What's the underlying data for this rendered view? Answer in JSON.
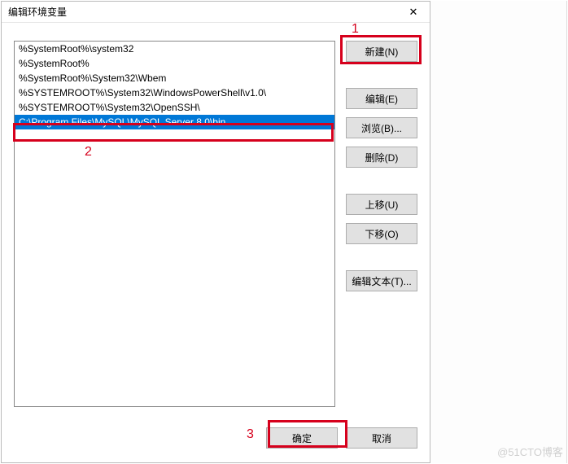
{
  "dialog": {
    "title": "编辑环境变量",
    "close": "✕"
  },
  "list": {
    "items": [
      "%SystemRoot%\\system32",
      "%SystemRoot%",
      "%SystemRoot%\\System32\\Wbem",
      "%SYSTEMROOT%\\System32\\WindowsPowerShell\\v1.0\\",
      "%SYSTEMROOT%\\System32\\OpenSSH\\",
      "C:\\Program Files\\MySQL\\MySQL Server 8.0\\bin"
    ],
    "selected_index": 5
  },
  "buttons": {
    "new": "新建(N)",
    "edit": "编辑(E)",
    "browse": "浏览(B)...",
    "delete": "删除(D)",
    "move_up": "上移(U)",
    "move_down": "下移(O)",
    "edit_text": "编辑文本(T)...",
    "ok": "确定",
    "cancel": "取消"
  },
  "annotations": {
    "label1": "1",
    "label2": "2",
    "label3": "3"
  },
  "watermark": "@51CTO博客"
}
